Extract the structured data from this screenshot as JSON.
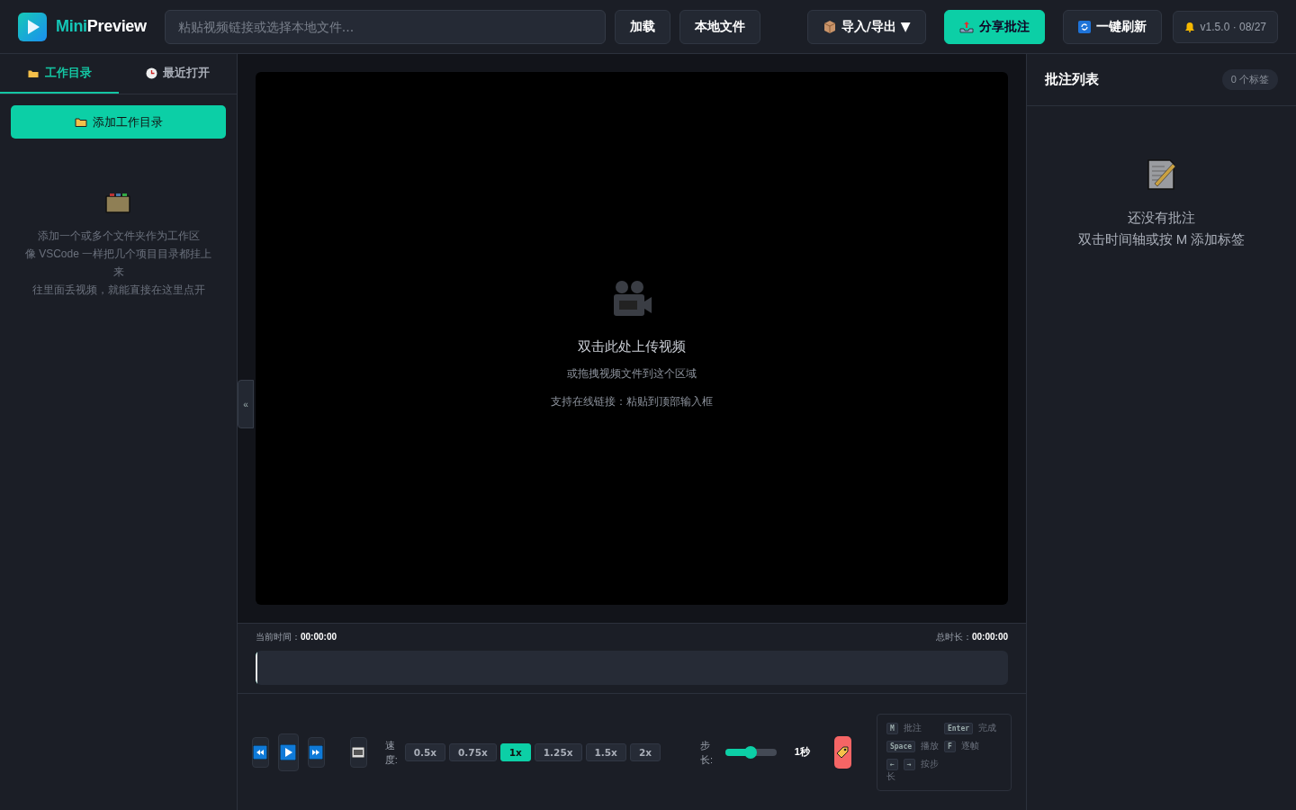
{
  "header": {
    "logo": {
      "part_a": "Mini",
      "part_b": "Preview"
    },
    "url_field": {
      "placeholder": "粘贴视频链接或选择本地文件..."
    },
    "buttons": [
      {
        "label": "加载",
        "kind": "plain"
      },
      {
        "label": "本地文件",
        "kind": "plain"
      },
      {
        "label": "导入/导出 ▼",
        "kind": "package"
      },
      {
        "label": "分享批注",
        "kind": "share"
      },
      {
        "label": "一键刷新",
        "kind": "refresh"
      }
    ],
    "version": "v1.5.0 · 08/27"
  },
  "sidebar": {
    "tabs": [
      {
        "label": "工作目录",
        "kind": "folder",
        "selected": true
      },
      {
        "label": "最近打开",
        "kind": "clock",
        "selected": false
      }
    ],
    "add_button": "添加工作目录",
    "empty_lines": [
      "添加一个或多个文件夹作为工作区",
      "像 VSCode 一样把几个项目目录都挂上来",
      "往里面丢视频，就能直接在这里点开"
    ],
    "collapse": "«"
  },
  "stage": {
    "title": "双击此处上传视频",
    "hint": "或拖拽视频文件到这个区域",
    "hint_link": "支持在线链接：粘贴到顶部输入框"
  },
  "timeline": {
    "current_label": "当前时间：",
    "current": "00:00:00",
    "total_label": "总时长：",
    "total": "00:00:00",
    "level": 0
  },
  "controls": {
    "speed_label": "速度:",
    "speeds": [
      {
        "label": "0.5x",
        "selected": false
      },
      {
        "label": "0.75x",
        "selected": false
      },
      {
        "label": "1x",
        "selected": true
      },
      {
        "label": "1.25x",
        "selected": false
      },
      {
        "label": "1.5x",
        "selected": false
      },
      {
        "label": "2x",
        "selected": false
      }
    ],
    "step_label": "步长:",
    "step": {
      "level": 0.5
    },
    "step_value": "1秒",
    "shortcuts": [
      {
        "keys": [
          "M"
        ],
        "text": "批注"
      },
      {
        "keys": [
          "Enter"
        ],
        "text": "完成"
      },
      {
        "keys": [
          "Space"
        ],
        "text": "播放"
      },
      {
        "keys": [
          "F"
        ],
        "text": "逐帧"
      },
      {
        "keys": [
          "←",
          "→"
        ],
        "text": "按步长"
      }
    ]
  },
  "notes": {
    "title": "批注列表",
    "count": "0 个标签",
    "empty_title": "还没有批注",
    "empty_hint": "双击时间轴或按 M 添加标签"
  }
}
